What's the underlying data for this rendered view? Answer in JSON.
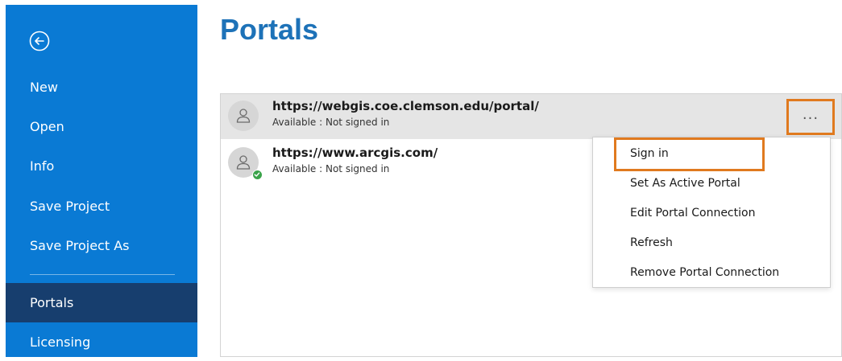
{
  "sidebar": {
    "back_icon": "back-arrow-circle-icon",
    "items": [
      {
        "label": "New"
      },
      {
        "label": "Open"
      },
      {
        "label": "Info"
      },
      {
        "label": "Save Project"
      },
      {
        "label": "Save Project As"
      },
      {
        "label": "Portals",
        "active": true
      },
      {
        "label": "Licensing"
      }
    ]
  },
  "main": {
    "title": "Portals",
    "portals": [
      {
        "url": "https://webgis.coe.clemson.edu/portal/",
        "status": "Available : Not signed in",
        "selected": true
      },
      {
        "url": "https://www.arcgis.com/",
        "status": "Available : Not signed in",
        "active": true
      }
    ],
    "more_label": "..."
  },
  "context_menu": {
    "items": [
      {
        "label": "Sign in"
      },
      {
        "label": "Set As Active Portal"
      },
      {
        "label": "Edit Portal Connection"
      },
      {
        "label": "Refresh"
      },
      {
        "label": "Remove Portal Connection"
      }
    ]
  },
  "colors": {
    "sidebar_bg": "#0a7ad4",
    "sidebar_active": "#173e6e",
    "title": "#1d72b8",
    "highlight": "#e07a1f",
    "status_ok": "#3aa34a"
  }
}
